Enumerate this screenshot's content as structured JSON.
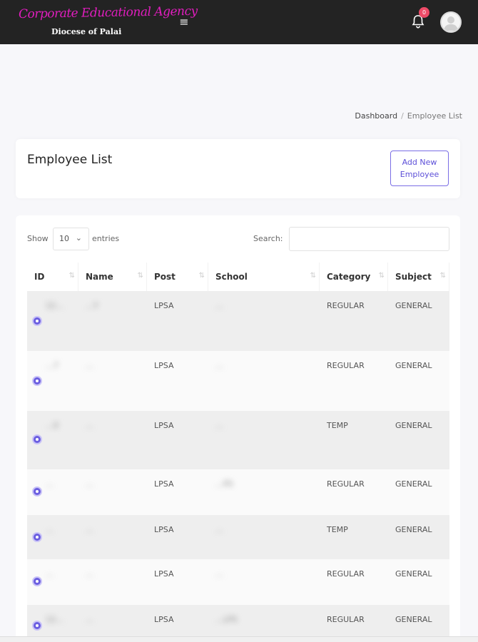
{
  "header": {
    "logo_title": "Corporate Educational Agency",
    "logo_subtitle": "Diocese of Palai",
    "menu_icon": "hamburger-menu-icon",
    "notification_icon": "bell-icon",
    "notification_count": "0",
    "avatar_icon": "user-avatar"
  },
  "breadcrumb": {
    "home": "Dashboard",
    "separator": "/",
    "current": "Employee List"
  },
  "page": {
    "title": "Employee List",
    "add_button": "Add New Employee"
  },
  "table_controls": {
    "show_label": "Show",
    "page_length": "10",
    "entries_label": "entries",
    "search_label": "Search:",
    "search_value": ""
  },
  "table": {
    "columns": [
      "ID",
      "Name",
      "Post",
      "School",
      "Category",
      "Subject"
    ],
    "rows": [
      {
        "id": "12…",
        "name": "…Y",
        "post": "LPSA",
        "school": "…",
        "category": "REGULAR",
        "subject": "GENERAL"
      },
      {
        "id": "…7",
        "name": "…",
        "post": "LPSA",
        "school": "…",
        "category": "REGULAR",
        "subject": "GENERAL"
      },
      {
        "id": "…0",
        "name": "…",
        "post": "LPSA",
        "school": "…",
        "category": "TEMP",
        "subject": "GENERAL"
      },
      {
        "id": "…",
        "name": "…",
        "post": "LPSA",
        "school": "…PS",
        "category": "REGULAR",
        "subject": "GENERAL"
      },
      {
        "id": "…",
        "name": "…",
        "post": "LPSA",
        "school": "…",
        "category": "TEMP",
        "subject": "GENERAL"
      },
      {
        "id": "…",
        "name": "…",
        "post": "LPSA",
        "school": "…",
        "category": "REGULAR",
        "subject": "GENERAL"
      },
      {
        "id": "12…",
        "name": "…",
        "post": "LPSA",
        "school": "…LPS",
        "category": "REGULAR",
        "subject": "GENERAL"
      }
    ]
  },
  "colors": {
    "topbar": "#232323",
    "logo": "#e21dbf",
    "accent": "#6b5ee0",
    "badge": "#ef4b68"
  }
}
